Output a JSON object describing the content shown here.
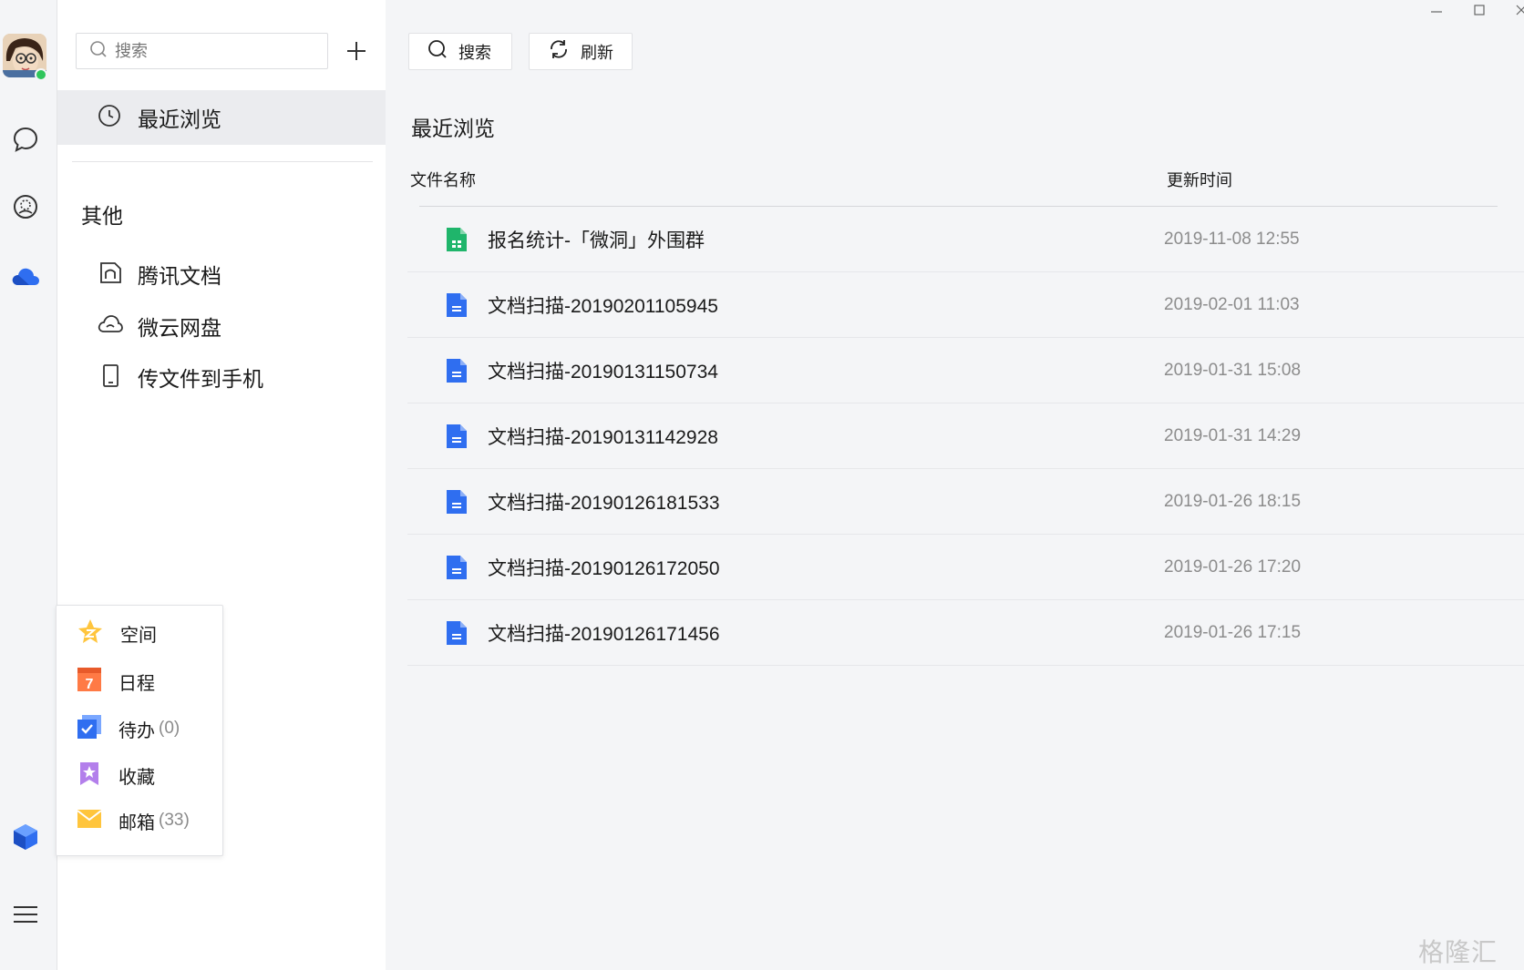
{
  "rail": {
    "avatar_status": "online",
    "icons": [
      "chat-icon",
      "contacts-icon",
      "cloud-icon",
      "workspace-icon",
      "menu-icon"
    ]
  },
  "sidebar": {
    "search_placeholder": "搜索",
    "recent_label": "最近浏览",
    "section_title": "其他",
    "items": [
      {
        "label": "腾讯文档",
        "icon": "tencent-docs-icon"
      },
      {
        "label": "微云网盘",
        "icon": "weiyun-cloud-icon"
      },
      {
        "label": "传文件到手机",
        "icon": "phone-icon"
      }
    ]
  },
  "popup": {
    "items": [
      {
        "label": "空间",
        "count": "",
        "icon": "space-star-icon"
      },
      {
        "label": "日程",
        "count": "",
        "icon": "calendar-icon"
      },
      {
        "label": "待办",
        "count": "(0)",
        "icon": "todo-icon"
      },
      {
        "label": "收藏",
        "count": "",
        "icon": "favorites-icon"
      },
      {
        "label": "邮箱",
        "count": "(33)",
        "icon": "mail-icon"
      }
    ]
  },
  "toolbar": {
    "search_label": "搜索",
    "refresh_label": "刷新"
  },
  "main": {
    "title": "最近浏览",
    "col_name": "文件名称",
    "col_time": "更新时间",
    "files": [
      {
        "name": "报名统计-「微洞」外围群",
        "time": "2019-11-08 12:55",
        "type": "sheet"
      },
      {
        "name": "文档扫描-20190201105945",
        "time": "2019-02-01 11:03",
        "type": "doc"
      },
      {
        "name": "文档扫描-20190131150734",
        "time": "2019-01-31 15:08",
        "type": "doc"
      },
      {
        "name": "文档扫描-20190131142928",
        "time": "2019-01-31 14:29",
        "type": "doc"
      },
      {
        "name": "文档扫描-20190126181533",
        "time": "2019-01-26 18:15",
        "type": "doc"
      },
      {
        "name": "文档扫描-20190126172050",
        "time": "2019-01-26 17:20",
        "type": "doc"
      },
      {
        "name": "文档扫描-20190126171456",
        "time": "2019-01-26 17:15",
        "type": "doc"
      }
    ]
  },
  "colors": {
    "sheet": "#1fb56b",
    "doc": "#2f6ef0",
    "online": "#2fc55c",
    "selected_bg": "#ebecef"
  },
  "watermark": "格隆汇"
}
